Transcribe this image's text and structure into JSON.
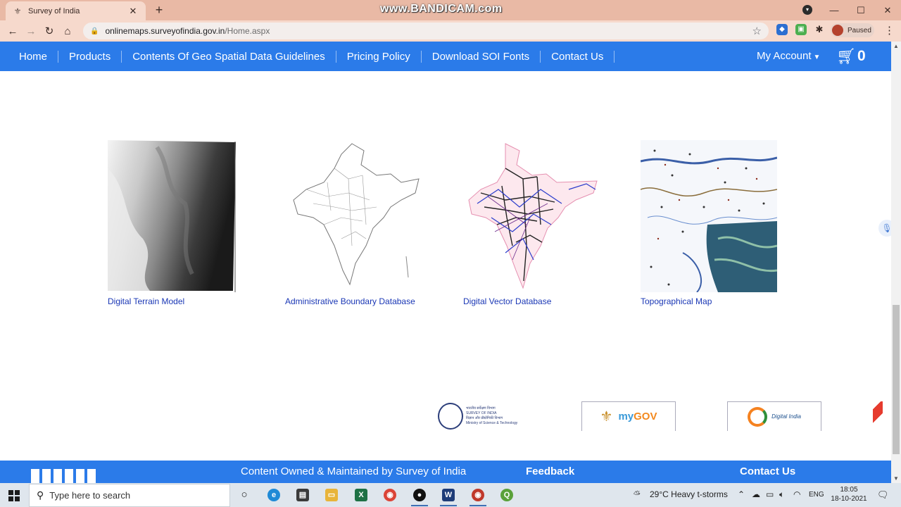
{
  "browser": {
    "tab_title": "Survey of India",
    "tab_close": "✕",
    "new_tab": "+",
    "watermark": "www.BANDICAM.com",
    "url_host": "onlinemaps.surveyofindia.gov.in",
    "url_path": "/Home.aspx",
    "profile_status": "Paused",
    "window_controls": [
      "—",
      "☐",
      "✕"
    ]
  },
  "nav": {
    "items": [
      "Home",
      "Products",
      "Contents Of Geo Spatial Data Guidelines",
      "Pricing Policy",
      "Download SOI Fonts",
      "Contact Us"
    ],
    "account": "My Account",
    "cart_count": "0"
  },
  "products": [
    {
      "caption": "Digital Terrain Model",
      "icon": "dtm-image"
    },
    {
      "caption": "Administrative Boundary Database",
      "icon": "boundary-map-image"
    },
    {
      "caption": "Digital Vector Database",
      "icon": "vector-map-image"
    },
    {
      "caption": "Topographical Map",
      "icon": "topo-map-image"
    }
  ],
  "partners": {
    "soi_lines": [
      "भारतीय सर्वेक्षण विभाग",
      "SURVEY OF INDIA",
      "विज्ञान और प्रौद्योगिकी विभाग",
      "Ministry of Science & Technology"
    ],
    "mygov_my": "my",
    "mygov_gov": "GOV",
    "digital_india": "Digital India"
  },
  "footer": {
    "owner": "Content Owned & Maintained by Survey of India",
    "feedback": "Feedback",
    "contact": "Contact Us"
  },
  "taskbar": {
    "search_placeholder": "Type here to search",
    "weather": "29°C  Heavy t-storms",
    "language": "ENG",
    "time": "18:05",
    "date": "18-10-2021"
  },
  "colors": {
    "nav_blue": "#2b7be9",
    "link_blue": "#1a37b5",
    "tab_strip": "#e9b9a5"
  }
}
